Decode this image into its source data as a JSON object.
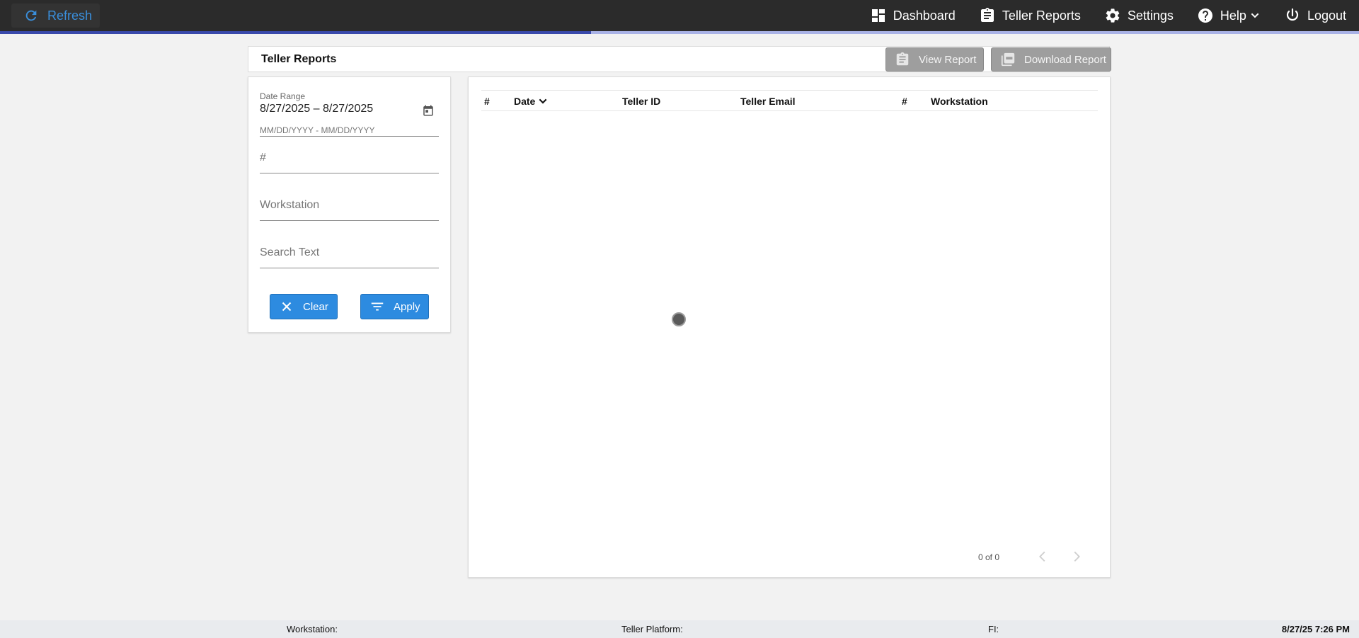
{
  "topbar": {
    "refresh_label": "Refresh",
    "nav": {
      "dashboard": "Dashboard",
      "teller_reports": "Teller Reports",
      "settings": "Settings",
      "help": "Help",
      "logout": "Logout"
    },
    "progress_fraction": 0.435
  },
  "page": {
    "title": "Teller Reports",
    "view_report_label": "View Report",
    "download_report_label": "Download Report"
  },
  "filters": {
    "date_range_label": "Date Range",
    "date_range_value": "8/27/2025 – 8/27/2025",
    "date_range_hint": "MM/DD/YYYY - MM/DD/YYYY",
    "number_placeholder": "#",
    "workstation_placeholder": "Workstation",
    "search_placeholder": "Search Text",
    "clear_label": "Clear",
    "apply_label": "Apply"
  },
  "table": {
    "columns": [
      "#",
      "Date",
      "Teller ID",
      "Teller Email",
      "#",
      "Workstation"
    ],
    "rows": [],
    "pager_text": "0 of 0"
  },
  "footer": {
    "workstation": "Workstation:",
    "teller_platform": "Teller Platform:",
    "fi": "FI:",
    "datetime": "8/27/25 7:26 PM"
  },
  "colors": {
    "topbar": "#2b2b2b",
    "accent": "#2d8be0",
    "progress": "#3949ab",
    "disabled_button": "#9e9e9e"
  }
}
